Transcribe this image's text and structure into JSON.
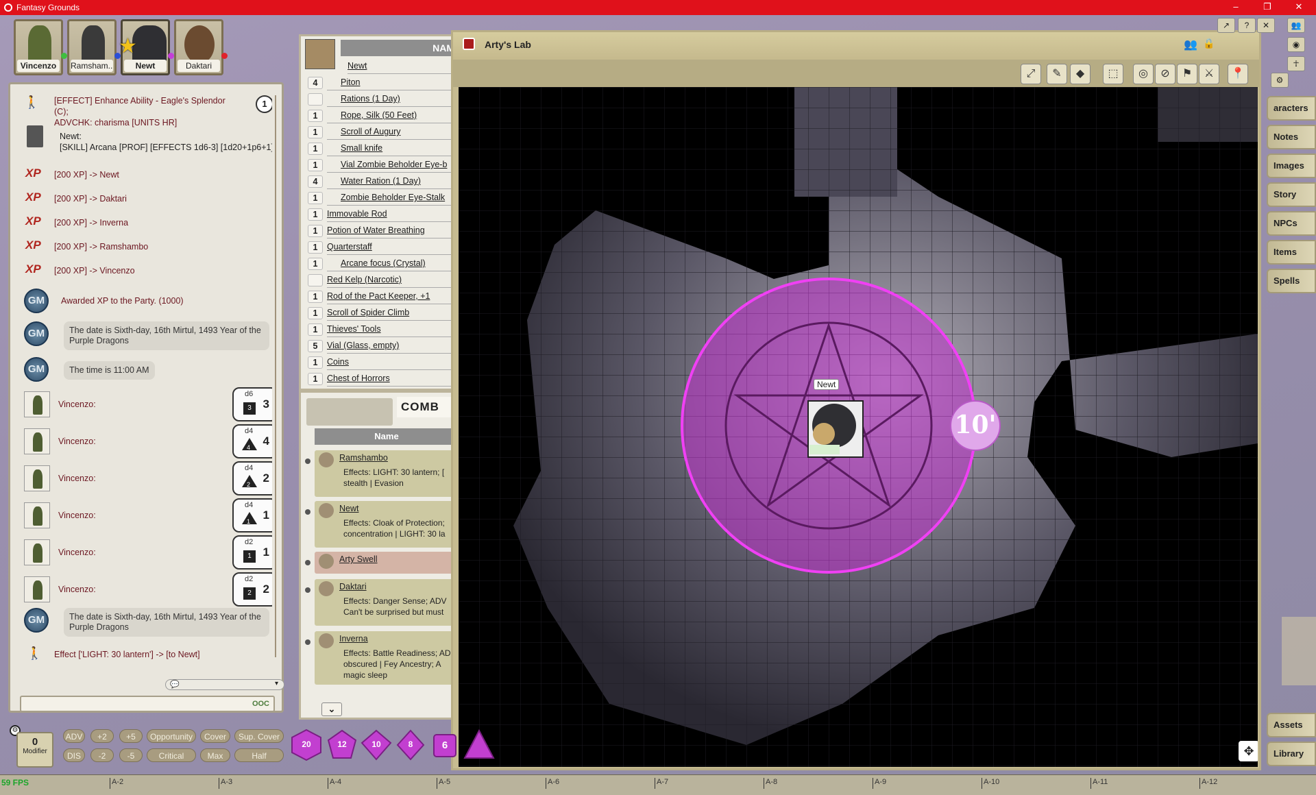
{
  "window": {
    "title": "Fantasy Grounds",
    "controls": [
      "–",
      "❐",
      "✕"
    ]
  },
  "party": [
    {
      "name": "Vincenzo",
      "dot": "#3fbf3f"
    },
    {
      "name": "Ramsham...",
      "dot": "#2b4fd6"
    },
    {
      "name": "Newt",
      "dot": "#c43ed8"
    },
    {
      "name": "Daktari",
      "dot": "#e0222c"
    }
  ],
  "chat": {
    "effect1_line1": "[EFFECT] Enhance Ability - Eagle's Splendor (C);",
    "effect1_line2": "ADVCHK: charisma [UNITS HR]",
    "effect1_count": "1",
    "newt_label": "Newt:",
    "newt_roll": "[SKILL] Arcana [PROF] [EFFECTS 1d6-3] [1d20+1p6+1]",
    "xp_badge": "XP",
    "xp": [
      "[200 XP] -> Newt",
      "[200 XP] -> Daktari",
      "[200 XP] -> Inverna",
      "[200 XP] -> Ramshambo",
      "[200 XP] -> Vincenzo"
    ],
    "gm_label": "GM",
    "awarded": "Awarded XP to the Party. (1000)",
    "date1_l1": "The date is Sixth-day, 16th Mirtul, 1493 Year of the",
    "date1_l2": "Purple Dragons",
    "time": "The time is 11:00 AM",
    "rolls": [
      {
        "who": "Vincenzo:",
        "die": "d6",
        "face": "3",
        "total": "3"
      },
      {
        "who": "Vincenzo:",
        "die": "d4",
        "face": "4",
        "total": "4"
      },
      {
        "who": "Vincenzo:",
        "die": "d4",
        "face": "2",
        "total": "2"
      },
      {
        "who": "Vincenzo:",
        "die": "d4",
        "face": "1",
        "total": "1"
      },
      {
        "who": "Vincenzo:",
        "die": "d2",
        "face": "1",
        "total": "1"
      },
      {
        "who": "Vincenzo:",
        "die": "d2",
        "face": "2",
        "total": "2"
      }
    ],
    "date2_l1": "The date is Sixth-day, 16th Mirtul, 1493 Year of the",
    "date2_l2": "Purple Dragons",
    "last_effect": "Effect ['LIGHT: 30 lantern'] -> [to Newt]",
    "ooc": "OOC"
  },
  "inventory": {
    "header": "NAM",
    "owner": "Newt",
    "items": [
      {
        "qty": "4",
        "name": "Piton",
        "indent": true
      },
      {
        "qty": "",
        "name": "Rations (1 Day)",
        "indent": true
      },
      {
        "qty": "1",
        "name": "Rope, Silk (50 Feet)",
        "indent": true
      },
      {
        "qty": "1",
        "name": "Scroll of Augury",
        "indent": true
      },
      {
        "qty": "1",
        "name": "Small knife",
        "indent": true
      },
      {
        "qty": "1",
        "name": "Vial Zombie Beholder Eye-b",
        "indent": true
      },
      {
        "qty": "4",
        "name": "Water Ration (1 Day)",
        "indent": true
      },
      {
        "qty": "1",
        "name": "Zombie Beholder Eye-Stalk",
        "indent": true
      },
      {
        "qty": "1",
        "name": "Immovable Rod",
        "indent": false
      },
      {
        "qty": "1",
        "name": "Potion of Water Breathing",
        "indent": false
      },
      {
        "qty": "1",
        "name": "Quarterstaff",
        "indent": false
      },
      {
        "qty": "1",
        "name": "Arcane focus (Crystal)",
        "indent": true
      },
      {
        "qty": "",
        "name": "Red Kelp (Narcotic)",
        "indent": false
      },
      {
        "qty": "1",
        "name": "Rod of the Pact Keeper, +1",
        "indent": false
      },
      {
        "qty": "1",
        "name": "Scroll of Spider Climb",
        "indent": false
      },
      {
        "qty": "1",
        "name": "Thieves' Tools",
        "indent": false
      },
      {
        "qty": "5",
        "name": "Vial (Glass, empty)",
        "indent": false
      },
      {
        "qty": "1",
        "name": "Coins",
        "indent": false
      },
      {
        "qty": "1",
        "name": "Chest of Horrors",
        "indent": false
      }
    ]
  },
  "combat": {
    "header": "COMB",
    "col": "Name",
    "entries": [
      {
        "name": "Ramshambo",
        "effects": [
          "Effects: LIGHT: 30 lantern; [",
          "stealth | Evasion"
        ],
        "active": false
      },
      {
        "name": "Newt",
        "effects": [
          "Effects: Cloak of Protection;",
          "concentration | LIGHT: 30 la"
        ],
        "active": false
      },
      {
        "name": "Arty Swell",
        "effects": [],
        "active": true
      },
      {
        "name": "Daktari",
        "effects": [
          "Effects: Danger Sense; ADV",
          "Can't be surprised but must"
        ],
        "active": false
      },
      {
        "name": "Inverna",
        "effects": [
          "Effects: Battle Readiness; AD",
          "obscured | Fey Ancestry; A",
          "magic sleep"
        ],
        "active": false
      }
    ]
  },
  "map": {
    "title": "Arty's Lab",
    "token_label": "Newt",
    "radius_label": "10'",
    "aura_color": "#d23ad6"
  },
  "sidebar": {
    "tabs": [
      "aracters",
      "Notes",
      "Images",
      "Story",
      "NPCs",
      "Items",
      "Spells"
    ],
    "bottom_tabs": [
      "Assets",
      "Library"
    ]
  },
  "toolbar": {
    "modifier_value": "0",
    "modifier_label": "Modifier",
    "row1": [
      "ADV",
      "+2",
      "+5",
      "Opportunity",
      "Cover",
      "Sup. Cover"
    ],
    "row2": [
      "DIS",
      "-2",
      "-5",
      "Critical",
      "Max",
      "Half"
    ],
    "dice": [
      "20",
      "12",
      "10",
      "8",
      "6"
    ]
  },
  "ruler": {
    "fps": "59 FPS",
    "labels": [
      "A-2",
      "A-3",
      "A-4",
      "A-5",
      "A-6",
      "A-7",
      "A-8",
      "A-9",
      "A-10",
      "A-11",
      "A-12"
    ]
  }
}
